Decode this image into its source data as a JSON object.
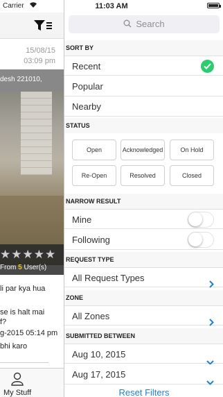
{
  "status_bar": {
    "carrier": "Carrier",
    "time": "11:03 AM"
  },
  "left_screen": {
    "date": "15/08/15",
    "time": "03:09 pm",
    "address": "desh 221010,",
    "rating_from_prefix": "From",
    "rating_count": "5",
    "rating_suffix": "User(s)",
    "comments": [
      "li par kya hua",
      "se is halt mai",
      "f?",
      "g-2015 05:14 pm",
      "bhi karo"
    ],
    "tab_label": "My Stuff",
    "tab_icon": "person-icon"
  },
  "search": {
    "placeholder": "Search",
    "icon": "search-icon"
  },
  "sections": {
    "sort_by": "SORT BY",
    "status": "STATUS",
    "narrow_result": "NARROW RESULT",
    "request_type": "REQUEST TYPE",
    "zone": "ZONE",
    "submitted_between": "SUBMITTED BETWEEN"
  },
  "sort_options": [
    "Recent",
    "Popular",
    "Nearby"
  ],
  "status_buttons": [
    "Open",
    "Acknowledged",
    "On Hold",
    "Re-Open",
    "Resolved",
    "Closed"
  ],
  "narrow": {
    "mine": "Mine",
    "following": "Following"
  },
  "request_type": {
    "value": "All Request Types"
  },
  "zone": {
    "value": "All Zones"
  },
  "dates": {
    "from": "Aug 10, 2015",
    "to": "Aug 17, 2015"
  },
  "reset_label": "Reset Filters",
  "colors": {
    "accent": "#1f7fd6",
    "check": "#2ecc71"
  }
}
